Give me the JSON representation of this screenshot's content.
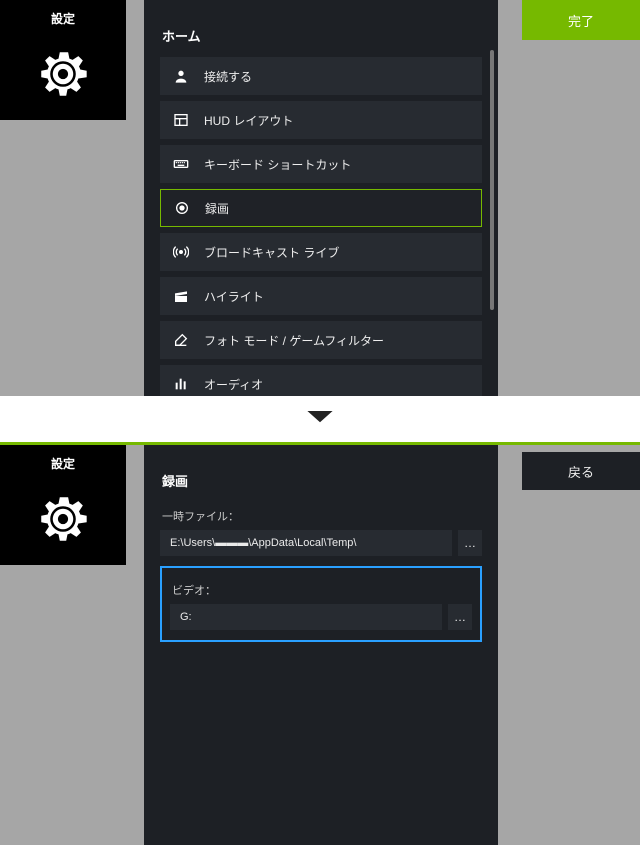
{
  "settings_label": "設定",
  "buttons": {
    "done": "完了",
    "back": "戻る"
  },
  "home": {
    "title": "ホーム",
    "items": [
      {
        "label": "接続する",
        "icon": "user-icon"
      },
      {
        "label": "HUD レイアウト",
        "icon": "layout-icon"
      },
      {
        "label": "キーボード ショートカット",
        "icon": "keyboard-icon"
      },
      {
        "label": "録画",
        "icon": "record-icon",
        "selected": true
      },
      {
        "label": "ブロードキャスト ライブ",
        "icon": "broadcast-icon"
      },
      {
        "label": "ハイライト",
        "icon": "clapper-icon"
      },
      {
        "label": "フォト モード / ゲームフィルター",
        "icon": "edit-icon"
      },
      {
        "label": "オーディオ",
        "icon": "equalizer-icon"
      }
    ]
  },
  "record": {
    "title": "録画",
    "temp_label": "一時ファイル：",
    "temp_path": "E:\\Users\\▬▬▬\\AppData\\Local\\Temp\\",
    "video_label": "ビデオ：",
    "video_path": "G:"
  },
  "colors": {
    "accent": "#76b900",
    "highlight": "#2aa0ff",
    "panel": "#1d2025",
    "item": "#272b31",
    "backdrop": "#a6a6a6"
  }
}
